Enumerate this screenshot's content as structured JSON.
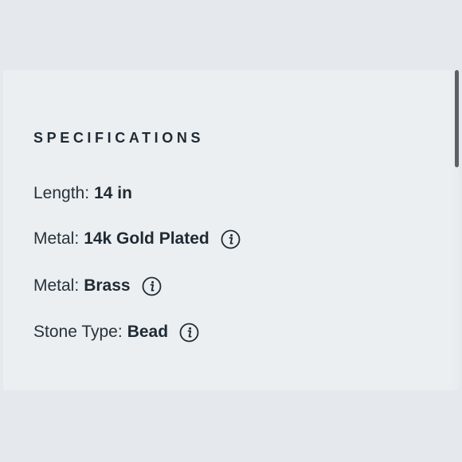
{
  "specifications": {
    "title": "SPECIFICATIONS",
    "items": [
      {
        "label": "Length:",
        "value": "14 in",
        "has_info": false
      },
      {
        "label": "Metal:",
        "value": "14k Gold Plated",
        "has_info": true,
        "icon": "info-icon"
      },
      {
        "label": "Metal:",
        "value": "Brass",
        "has_info": true,
        "icon": "info-icon"
      },
      {
        "label": "Stone Type:",
        "value": "Bead",
        "has_info": true,
        "icon": "info-icon"
      }
    ]
  },
  "colors": {
    "page_background": "#e5e9ed",
    "panel_background": "#ebeff2",
    "text": "#1f2a33",
    "scrollbar_thumb": "#5b6167"
  }
}
